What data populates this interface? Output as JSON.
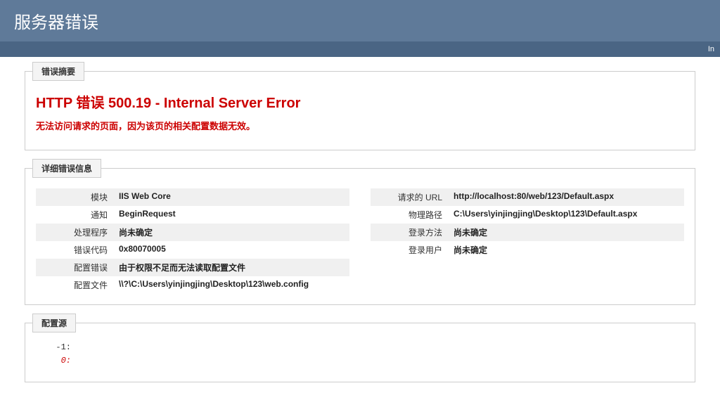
{
  "header": {
    "title": "服务器错误",
    "menu_hint": "In"
  },
  "summary": {
    "tab": "错误摘要",
    "title": "HTTP 错误 500.19 - Internal Server Error",
    "subtitle": "无法访问请求的页面，因为该页的相关配置数据无效。"
  },
  "details": {
    "tab": "详细错误信息",
    "left": [
      {
        "label": "模块",
        "value": "IIS Web Core"
      },
      {
        "label": "通知",
        "value": "BeginRequest"
      },
      {
        "label": "处理程序",
        "value": "尚未确定"
      },
      {
        "label": "错误代码",
        "value": "0x80070005"
      },
      {
        "label": "配置错误",
        "value": "由于权限不足而无法读取配置文件"
      },
      {
        "label": "配置文件",
        "value": "\\\\?\\C:\\Users\\yinjingjing\\Desktop\\123\\web.config"
      }
    ],
    "right": [
      {
        "label": "请求的 URL",
        "value": "http://localhost:80/web/123/Default.aspx"
      },
      {
        "label": "物理路径",
        "value": "C:\\Users\\yinjingjing\\Desktop\\123\\Default.aspx"
      },
      {
        "label": "登录方法",
        "value": "尚未确定"
      },
      {
        "label": "登录用户",
        "value": "尚未确定"
      }
    ]
  },
  "config": {
    "tab": "配置源",
    "lines": [
      {
        "num": "-1:",
        "text": "",
        "cls": ""
      },
      {
        "num": "0:",
        "text": "",
        "cls": "config-line-0"
      }
    ]
  }
}
